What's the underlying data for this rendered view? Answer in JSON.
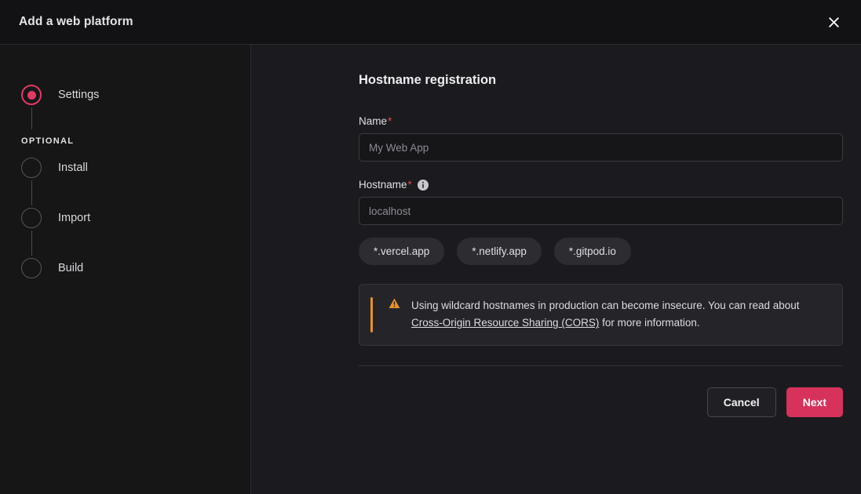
{
  "header": {
    "title": "Add a web platform",
    "close_label": "×",
    "close_icon": "close-icon"
  },
  "sidebar": {
    "optional_label": "OPTIONAL",
    "steps_primary": [
      {
        "label": "Settings",
        "active": true
      }
    ],
    "steps_optional": [
      {
        "label": "Install",
        "active": false
      },
      {
        "label": "Import",
        "active": false
      },
      {
        "label": "Build",
        "active": false
      }
    ]
  },
  "main": {
    "section_title": "Hostname registration",
    "fields": {
      "name": {
        "label": "Name",
        "required_marker": "*",
        "value": "",
        "placeholder": "My Web App"
      },
      "hostname": {
        "label": "Hostname",
        "required_marker": "*",
        "info_icon": "info-icon",
        "value": "",
        "placeholder": "localhost"
      }
    },
    "chips": [
      {
        "label": "*.vercel.app"
      },
      {
        "label": "*.netlify.app"
      },
      {
        "label": "*.gitpod.io"
      }
    ],
    "callout": {
      "icon": "warning-triangle-icon",
      "text_before": "Using wildcard hostnames in production can become insecure. You can read about ",
      "link_text": "Cross-Origin Resource Sharing (CORS)",
      "text_after": " for more information."
    },
    "actions": {
      "cancel_label": "Cancel",
      "next_label": "Next"
    }
  },
  "colors": {
    "accent_pink": "#d6325c",
    "step_active": "#e03a63",
    "warning_orange": "#e8912a",
    "required_red": "#e04a4a",
    "header_bg": "#121214",
    "sidebar_bg": "#161617",
    "panel_bg": "#1b1b1f",
    "chip_bg": "#2c2c31",
    "callout_bg": "#252529"
  }
}
